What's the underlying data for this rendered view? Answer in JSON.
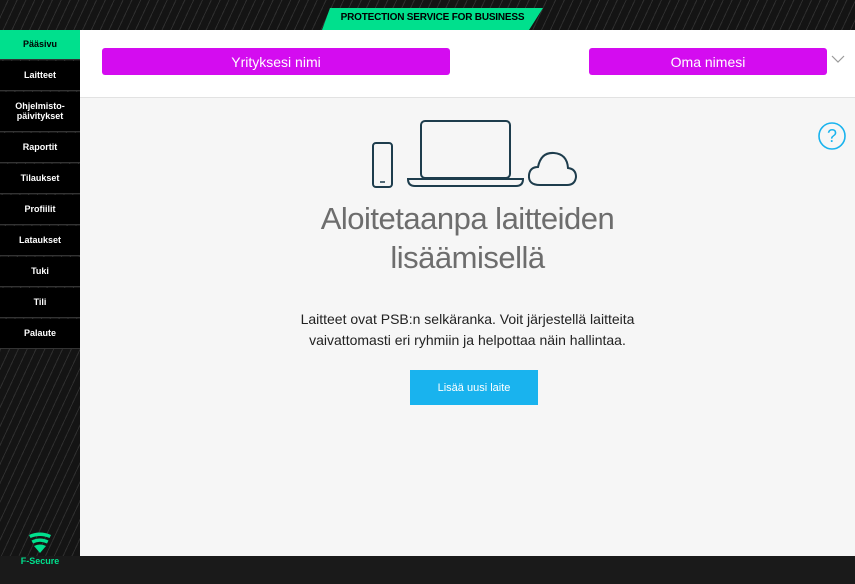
{
  "topbar": {
    "brand_label": "PROTECTION SERVICE FOR BUSINESS",
    "accent": "#00e08d"
  },
  "sidebar": {
    "items": [
      {
        "label": "Pääsivu",
        "active": true
      },
      {
        "label": "Laitteet"
      },
      {
        "label": "Ohjelmisto-\npäivitykset"
      },
      {
        "label": "Raportit"
      },
      {
        "label": "Tilaukset"
      },
      {
        "label": "Profiilit"
      },
      {
        "label": "Lataukset"
      },
      {
        "label": "Tuki"
      },
      {
        "label": "Tili"
      },
      {
        "label": "Palaute"
      }
    ],
    "logo_text": "F-Secure"
  },
  "header": {
    "company_name": "Yrityksesi nimi",
    "user_name": "Oma nimesi",
    "highlight_color": "#d40cf0"
  },
  "main": {
    "title_line1": "Aloitetaanpa laitteiden",
    "title_line2": "lisäämisellä",
    "desc_line1": "Laitteet ovat PSB:n selkäranka. Voit järjestellä laitteita",
    "desc_line2": "vaivattomasti eri ryhmiin ja helpottaa näin hallintaa.",
    "add_button": "Lisää uusi laite",
    "button_color": "#19b3ee",
    "icons": [
      "phone-icon",
      "laptop-icon",
      "cloud-icon",
      "help-icon"
    ]
  }
}
